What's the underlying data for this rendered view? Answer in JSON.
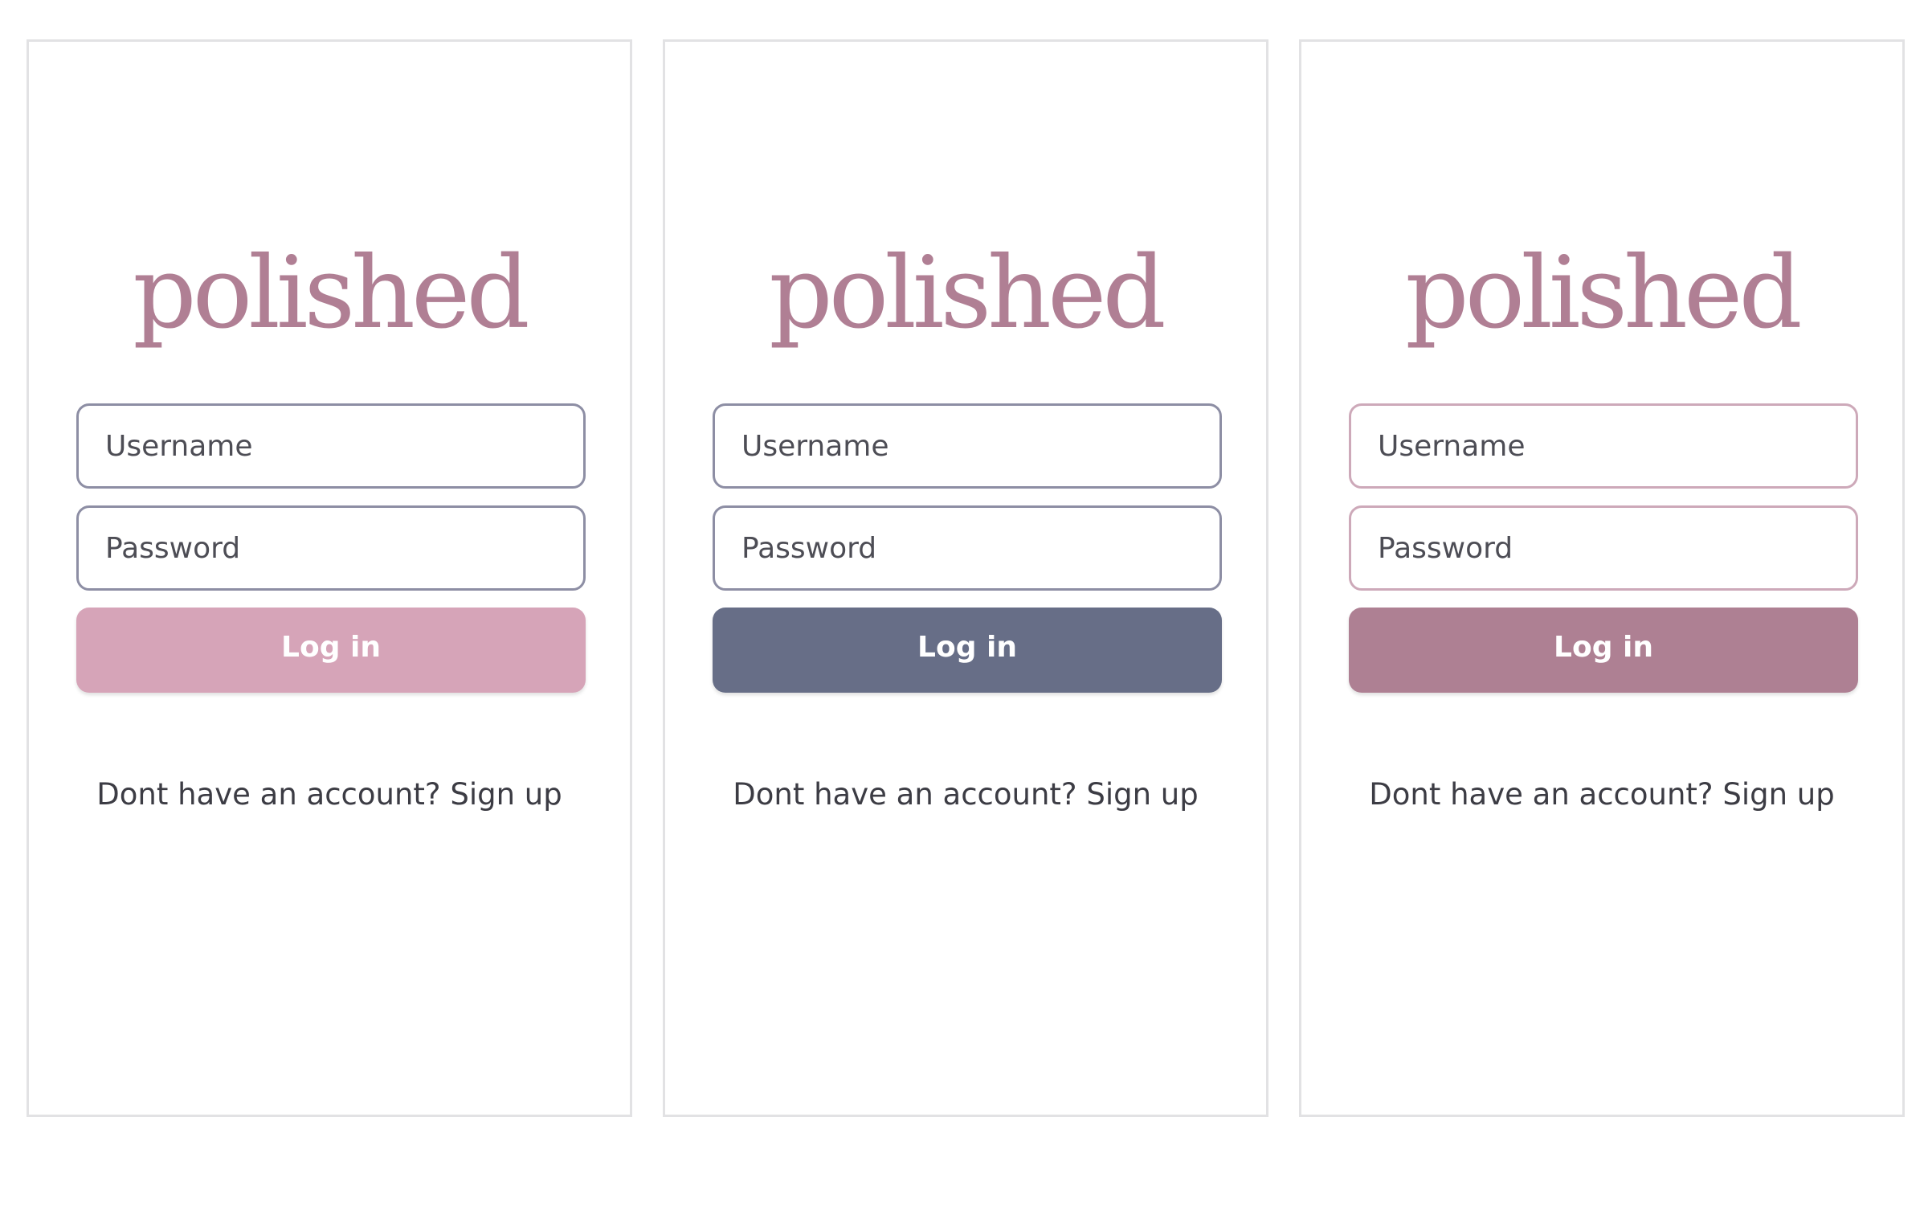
{
  "brand": {
    "logo_text": "polished",
    "logo_color": "#b07f94"
  },
  "screens": [
    {
      "username_placeholder": "Username",
      "password_placeholder": "Password",
      "login_label": "Log in",
      "login_color": "#d6a4b8",
      "field_border_color": "#8d8ea4",
      "signup_prompt": "Dont have an account?",
      "signup_link": "Sign up"
    },
    {
      "username_placeholder": "Username",
      "password_placeholder": "Password",
      "login_label": "Log in",
      "login_color": "#676e87",
      "field_border_color": "#8d8ea4",
      "signup_prompt": "Dont have an account?",
      "signup_link": "Sign up"
    },
    {
      "username_placeholder": "Username",
      "password_placeholder": "Password",
      "login_label": "Log in",
      "login_color": "#ae8093",
      "field_border_color": "#cda9b9",
      "signup_prompt": "Dont have an account?",
      "signup_link": "Sign up"
    }
  ]
}
